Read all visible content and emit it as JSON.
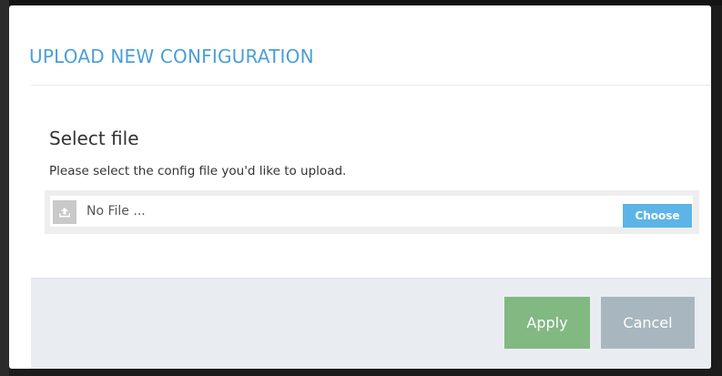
{
  "dialog": {
    "title": "UPLOAD NEW CONFIGURATION",
    "section_heading": "Select file",
    "description": "Please select the config file you'd like to upload.",
    "file_input": {
      "icon": "upload-icon",
      "placeholder": "No File ...",
      "choose_label": "Choose"
    },
    "footer": {
      "apply_label": "Apply",
      "cancel_label": "Cancel"
    }
  },
  "colors": {
    "title": "#4a9fd8",
    "choose_button": "#5cb5e6",
    "apply_button": "#82b882",
    "cancel_button": "#a8b6bf",
    "footer_bg": "#e9edf2"
  }
}
